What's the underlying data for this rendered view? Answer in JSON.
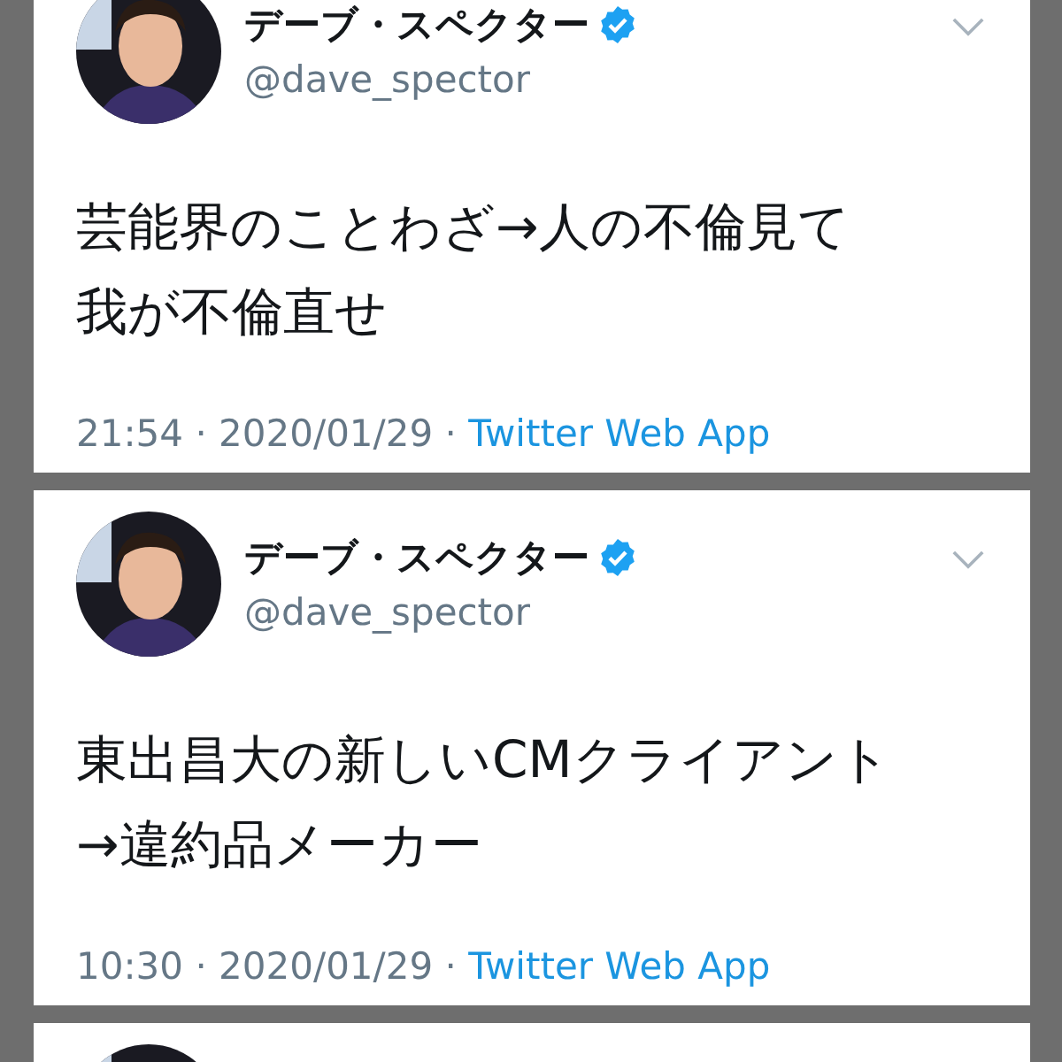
{
  "tweets": [
    {
      "name": "デーブ・スペクター",
      "verified": true,
      "handle": "@dave_spector",
      "text": [
        "芸能界のことわざ→人の不倫見て",
        "我が不倫直せ"
      ],
      "timestamp": "21:54 · 2020/01/29 · ",
      "source": "Twitter Web App"
    },
    {
      "name": "デーブ・スペクター",
      "verified": true,
      "handle": "@dave_spector",
      "text": [
        "東出昌大の新しいCMクライアント",
        "→違約品メーカー"
      ],
      "timestamp": "10:30 · 2020/01/29 · ",
      "source": "Twitter Web App"
    }
  ]
}
